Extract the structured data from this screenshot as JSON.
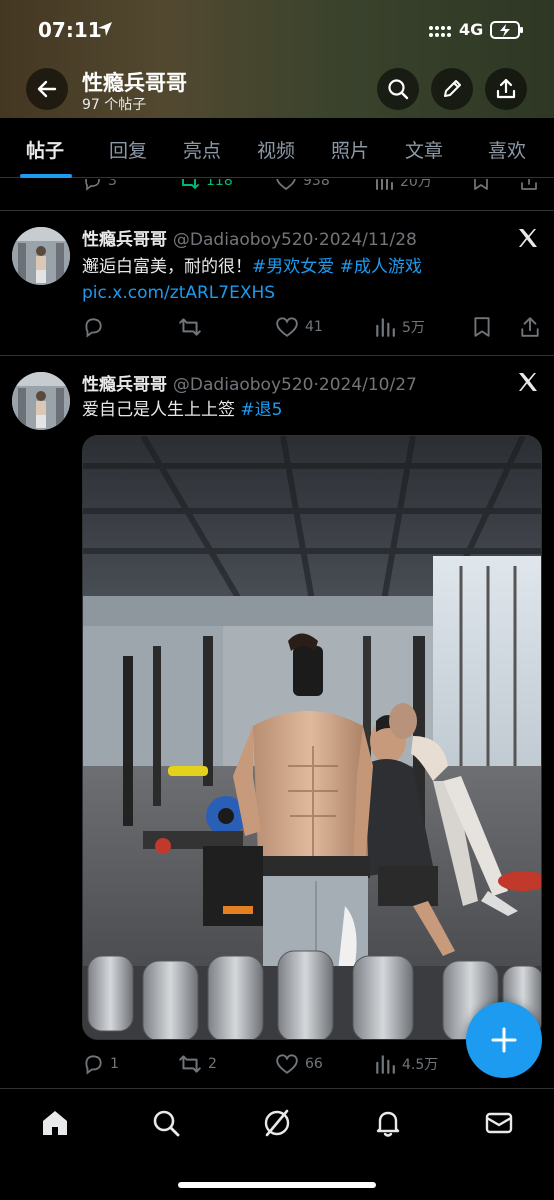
{
  "status_bar": {
    "time": "07:11",
    "network": "4G"
  },
  "profile_header": {
    "name": "性瘾兵哥哥",
    "post_count": "97 个帖子"
  },
  "tabs": [
    {
      "label": "帖子"
    },
    {
      "label": "回复"
    },
    {
      "label": "亮点"
    },
    {
      "label": "视频"
    },
    {
      "label": "照片"
    },
    {
      "label": "文章"
    },
    {
      "label": "喜欢"
    }
  ],
  "partial_post": {
    "replies": "3",
    "reposts": "118",
    "likes": "938",
    "views": "20万"
  },
  "posts": [
    {
      "name": "性瘾兵哥哥",
      "handle": "@Dadiaoboy520",
      "dot": "·",
      "date": "2024/11/28",
      "text": "邂逅白富美，耐的很！",
      "hashtags": [
        "#男欢女爱",
        "#成人游戏"
      ],
      "link": "pic.x.com/ztARL7EXHS",
      "replies": "",
      "reposts": "",
      "likes": "41",
      "views": "5万"
    },
    {
      "name": "性瘾兵哥哥",
      "handle": "@Dadiaoboy520",
      "dot": "·",
      "date": "2024/10/27",
      "text": "爱自己是人生上上签",
      "hashtags": [
        "#退5"
      ],
      "replies": "1",
      "reposts": "2",
      "likes": "66",
      "views": "4.5万"
    }
  ],
  "colors": {
    "accent": "#1d9bf0",
    "repost_active": "#00ba7c",
    "muted": "#71767b",
    "background": "#000000"
  }
}
